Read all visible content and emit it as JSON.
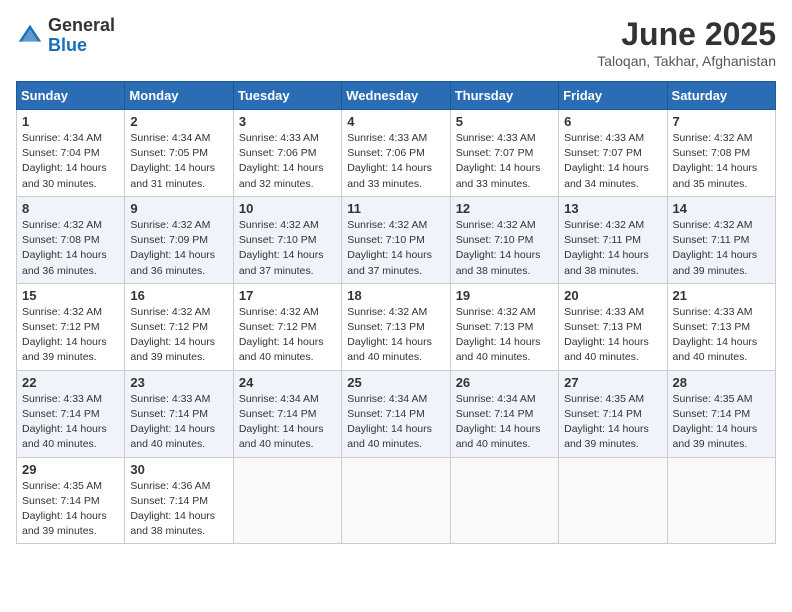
{
  "header": {
    "logo_general": "General",
    "logo_blue": "Blue",
    "month_title": "June 2025",
    "subtitle": "Taloqan, Takhar, Afghanistan"
  },
  "weekdays": [
    "Sunday",
    "Monday",
    "Tuesday",
    "Wednesday",
    "Thursday",
    "Friday",
    "Saturday"
  ],
  "weeks": [
    [
      {
        "day": "1",
        "sunrise": "4:34 AM",
        "sunset": "7:04 PM",
        "daylight": "14 hours and 30 minutes."
      },
      {
        "day": "2",
        "sunrise": "4:34 AM",
        "sunset": "7:05 PM",
        "daylight": "14 hours and 31 minutes."
      },
      {
        "day": "3",
        "sunrise": "4:33 AM",
        "sunset": "7:06 PM",
        "daylight": "14 hours and 32 minutes."
      },
      {
        "day": "4",
        "sunrise": "4:33 AM",
        "sunset": "7:06 PM",
        "daylight": "14 hours and 33 minutes."
      },
      {
        "day": "5",
        "sunrise": "4:33 AM",
        "sunset": "7:07 PM",
        "daylight": "14 hours and 33 minutes."
      },
      {
        "day": "6",
        "sunrise": "4:33 AM",
        "sunset": "7:07 PM",
        "daylight": "14 hours and 34 minutes."
      },
      {
        "day": "7",
        "sunrise": "4:32 AM",
        "sunset": "7:08 PM",
        "daylight": "14 hours and 35 minutes."
      }
    ],
    [
      {
        "day": "8",
        "sunrise": "4:32 AM",
        "sunset": "7:08 PM",
        "daylight": "14 hours and 36 minutes."
      },
      {
        "day": "9",
        "sunrise": "4:32 AM",
        "sunset": "7:09 PM",
        "daylight": "14 hours and 36 minutes."
      },
      {
        "day": "10",
        "sunrise": "4:32 AM",
        "sunset": "7:10 PM",
        "daylight": "14 hours and 37 minutes."
      },
      {
        "day": "11",
        "sunrise": "4:32 AM",
        "sunset": "7:10 PM",
        "daylight": "14 hours and 37 minutes."
      },
      {
        "day": "12",
        "sunrise": "4:32 AM",
        "sunset": "7:10 PM",
        "daylight": "14 hours and 38 minutes."
      },
      {
        "day": "13",
        "sunrise": "4:32 AM",
        "sunset": "7:11 PM",
        "daylight": "14 hours and 38 minutes."
      },
      {
        "day": "14",
        "sunrise": "4:32 AM",
        "sunset": "7:11 PM",
        "daylight": "14 hours and 39 minutes."
      }
    ],
    [
      {
        "day": "15",
        "sunrise": "4:32 AM",
        "sunset": "7:12 PM",
        "daylight": "14 hours and 39 minutes."
      },
      {
        "day": "16",
        "sunrise": "4:32 AM",
        "sunset": "7:12 PM",
        "daylight": "14 hours and 39 minutes."
      },
      {
        "day": "17",
        "sunrise": "4:32 AM",
        "sunset": "7:12 PM",
        "daylight": "14 hours and 40 minutes."
      },
      {
        "day": "18",
        "sunrise": "4:32 AM",
        "sunset": "7:13 PM",
        "daylight": "14 hours and 40 minutes."
      },
      {
        "day": "19",
        "sunrise": "4:32 AM",
        "sunset": "7:13 PM",
        "daylight": "14 hours and 40 minutes."
      },
      {
        "day": "20",
        "sunrise": "4:33 AM",
        "sunset": "7:13 PM",
        "daylight": "14 hours and 40 minutes."
      },
      {
        "day": "21",
        "sunrise": "4:33 AM",
        "sunset": "7:13 PM",
        "daylight": "14 hours and 40 minutes."
      }
    ],
    [
      {
        "day": "22",
        "sunrise": "4:33 AM",
        "sunset": "7:14 PM",
        "daylight": "14 hours and 40 minutes."
      },
      {
        "day": "23",
        "sunrise": "4:33 AM",
        "sunset": "7:14 PM",
        "daylight": "14 hours and 40 minutes."
      },
      {
        "day": "24",
        "sunrise": "4:34 AM",
        "sunset": "7:14 PM",
        "daylight": "14 hours and 40 minutes."
      },
      {
        "day": "25",
        "sunrise": "4:34 AM",
        "sunset": "7:14 PM",
        "daylight": "14 hours and 40 minutes."
      },
      {
        "day": "26",
        "sunrise": "4:34 AM",
        "sunset": "7:14 PM",
        "daylight": "14 hours and 40 minutes."
      },
      {
        "day": "27",
        "sunrise": "4:35 AM",
        "sunset": "7:14 PM",
        "daylight": "14 hours and 39 minutes."
      },
      {
        "day": "28",
        "sunrise": "4:35 AM",
        "sunset": "7:14 PM",
        "daylight": "14 hours and 39 minutes."
      }
    ],
    [
      {
        "day": "29",
        "sunrise": "4:35 AM",
        "sunset": "7:14 PM",
        "daylight": "14 hours and 39 minutes."
      },
      {
        "day": "30",
        "sunrise": "4:36 AM",
        "sunset": "7:14 PM",
        "daylight": "14 hours and 38 minutes."
      },
      null,
      null,
      null,
      null,
      null
    ]
  ]
}
